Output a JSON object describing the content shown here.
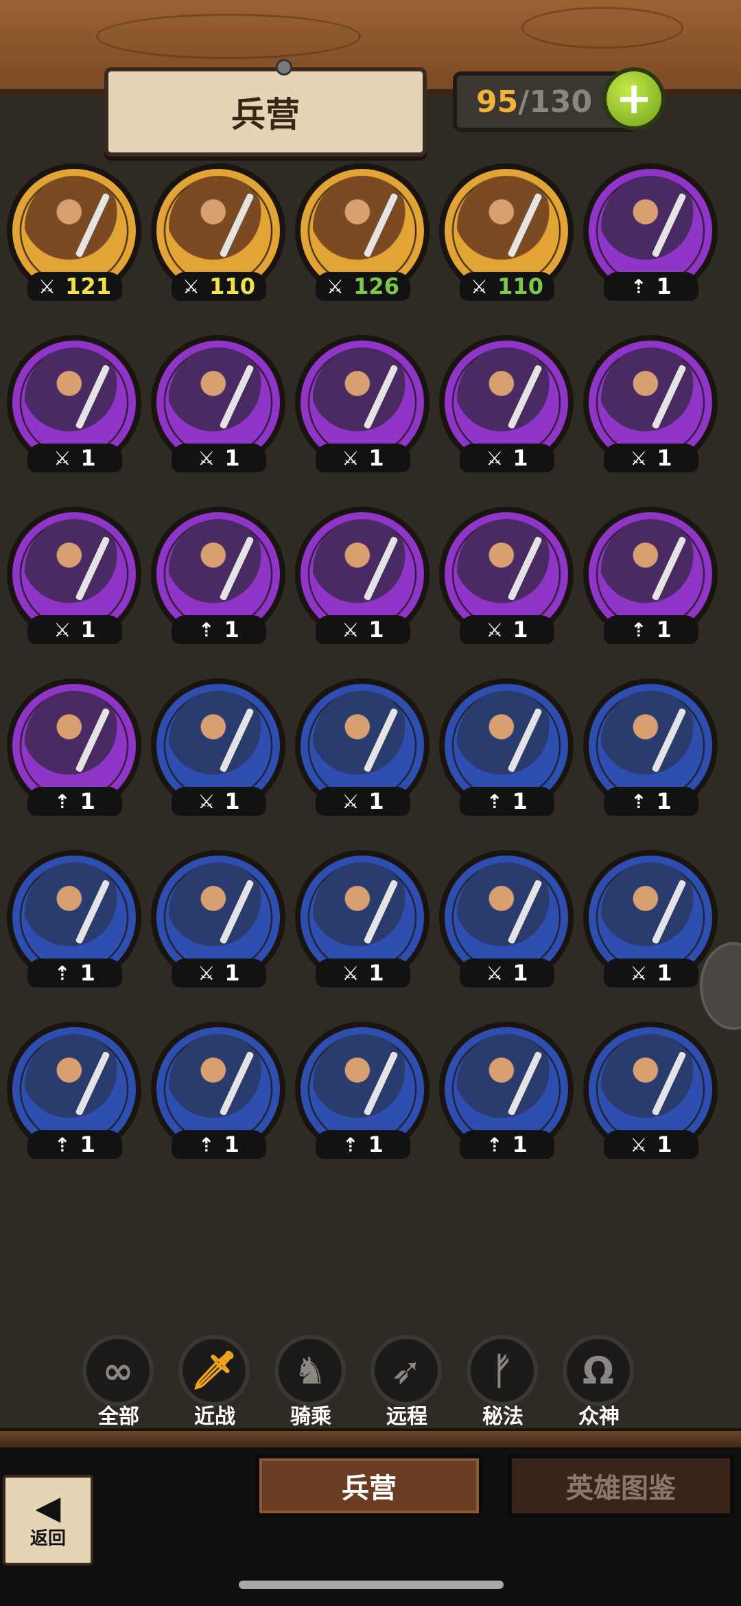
{
  "header": {
    "title": "兵营",
    "capacity_current": "95",
    "capacity_separator": "/",
    "capacity_max": "130",
    "add_button_icon": "plus-icon"
  },
  "colors": {
    "gold_ring": "#e3a436",
    "purple_ring": "#8f35c7",
    "blue_ring": "#2f4fb0",
    "count_green": "#7ec84a",
    "count_yellow": "#f0e24a",
    "accent_orange": "#f1a61c"
  },
  "units": [
    {
      "rarity": "gold",
      "type": "melee",
      "count": "121",
      "count_color": "yellow"
    },
    {
      "rarity": "gold",
      "type": "melee",
      "count": "110",
      "count_color": "yellow"
    },
    {
      "rarity": "gold",
      "type": "melee",
      "count": "126",
      "count_color": "green"
    },
    {
      "rarity": "gold",
      "type": "melee",
      "count": "110",
      "count_color": "green"
    },
    {
      "rarity": "purple",
      "type": "ranged",
      "count": "1",
      "count_color": "white"
    },
    {
      "rarity": "purple",
      "type": "melee",
      "count": "1",
      "count_color": "white"
    },
    {
      "rarity": "purple",
      "type": "melee",
      "count": "1",
      "count_color": "white"
    },
    {
      "rarity": "purple",
      "type": "melee",
      "count": "1",
      "count_color": "white"
    },
    {
      "rarity": "purple",
      "type": "melee",
      "count": "1",
      "count_color": "white"
    },
    {
      "rarity": "purple",
      "type": "melee",
      "count": "1",
      "count_color": "white"
    },
    {
      "rarity": "purple",
      "type": "melee",
      "count": "1",
      "count_color": "white"
    },
    {
      "rarity": "purple",
      "type": "ranged",
      "count": "1",
      "count_color": "white"
    },
    {
      "rarity": "purple",
      "type": "melee",
      "count": "1",
      "count_color": "white"
    },
    {
      "rarity": "purple",
      "type": "melee",
      "count": "1",
      "count_color": "white"
    },
    {
      "rarity": "purple",
      "type": "ranged",
      "count": "1",
      "count_color": "white"
    },
    {
      "rarity": "purple",
      "type": "ranged",
      "count": "1",
      "count_color": "white"
    },
    {
      "rarity": "blue",
      "type": "melee",
      "count": "1",
      "count_color": "white"
    },
    {
      "rarity": "blue",
      "type": "melee",
      "count": "1",
      "count_color": "white"
    },
    {
      "rarity": "blue",
      "type": "ranged",
      "count": "1",
      "count_color": "white"
    },
    {
      "rarity": "blue",
      "type": "ranged",
      "count": "1",
      "count_color": "white"
    },
    {
      "rarity": "blue",
      "type": "ranged",
      "count": "1",
      "count_color": "white"
    },
    {
      "rarity": "blue",
      "type": "melee",
      "count": "1",
      "count_color": "white"
    },
    {
      "rarity": "blue",
      "type": "melee",
      "count": "1",
      "count_color": "white"
    },
    {
      "rarity": "blue",
      "type": "melee",
      "count": "1",
      "count_color": "white"
    },
    {
      "rarity": "blue",
      "type": "melee",
      "count": "1",
      "count_color": "white"
    },
    {
      "rarity": "blue",
      "type": "ranged",
      "count": "1",
      "count_color": "white"
    },
    {
      "rarity": "blue",
      "type": "ranged",
      "count": "1",
      "count_color": "white"
    },
    {
      "rarity": "blue",
      "type": "ranged",
      "count": "1",
      "count_color": "white"
    },
    {
      "rarity": "blue",
      "type": "ranged",
      "count": "1",
      "count_color": "white"
    },
    {
      "rarity": "blue",
      "type": "melee",
      "count": "1",
      "count_color": "white"
    }
  ],
  "filters": [
    {
      "label": "全部",
      "icon": "infinity-icon",
      "glyph": "∞",
      "active": false
    },
    {
      "label": "近战",
      "icon": "sword-icon",
      "glyph": "🗡",
      "active": true
    },
    {
      "label": "骑乘",
      "icon": "horse-icon",
      "glyph": "♞",
      "active": false
    },
    {
      "label": "远程",
      "icon": "bow-icon",
      "glyph": "➶",
      "active": false
    },
    {
      "label": "秘法",
      "icon": "rune-icon",
      "glyph": "ᚠ",
      "active": false
    },
    {
      "label": "众神",
      "icon": "omega-icon",
      "glyph": "Ω",
      "active": false
    }
  ],
  "tabs": {
    "barracks": "兵营",
    "hero_codex": "英雄图鉴"
  },
  "back": {
    "label": "返回",
    "icon": "back-arrow-icon"
  }
}
